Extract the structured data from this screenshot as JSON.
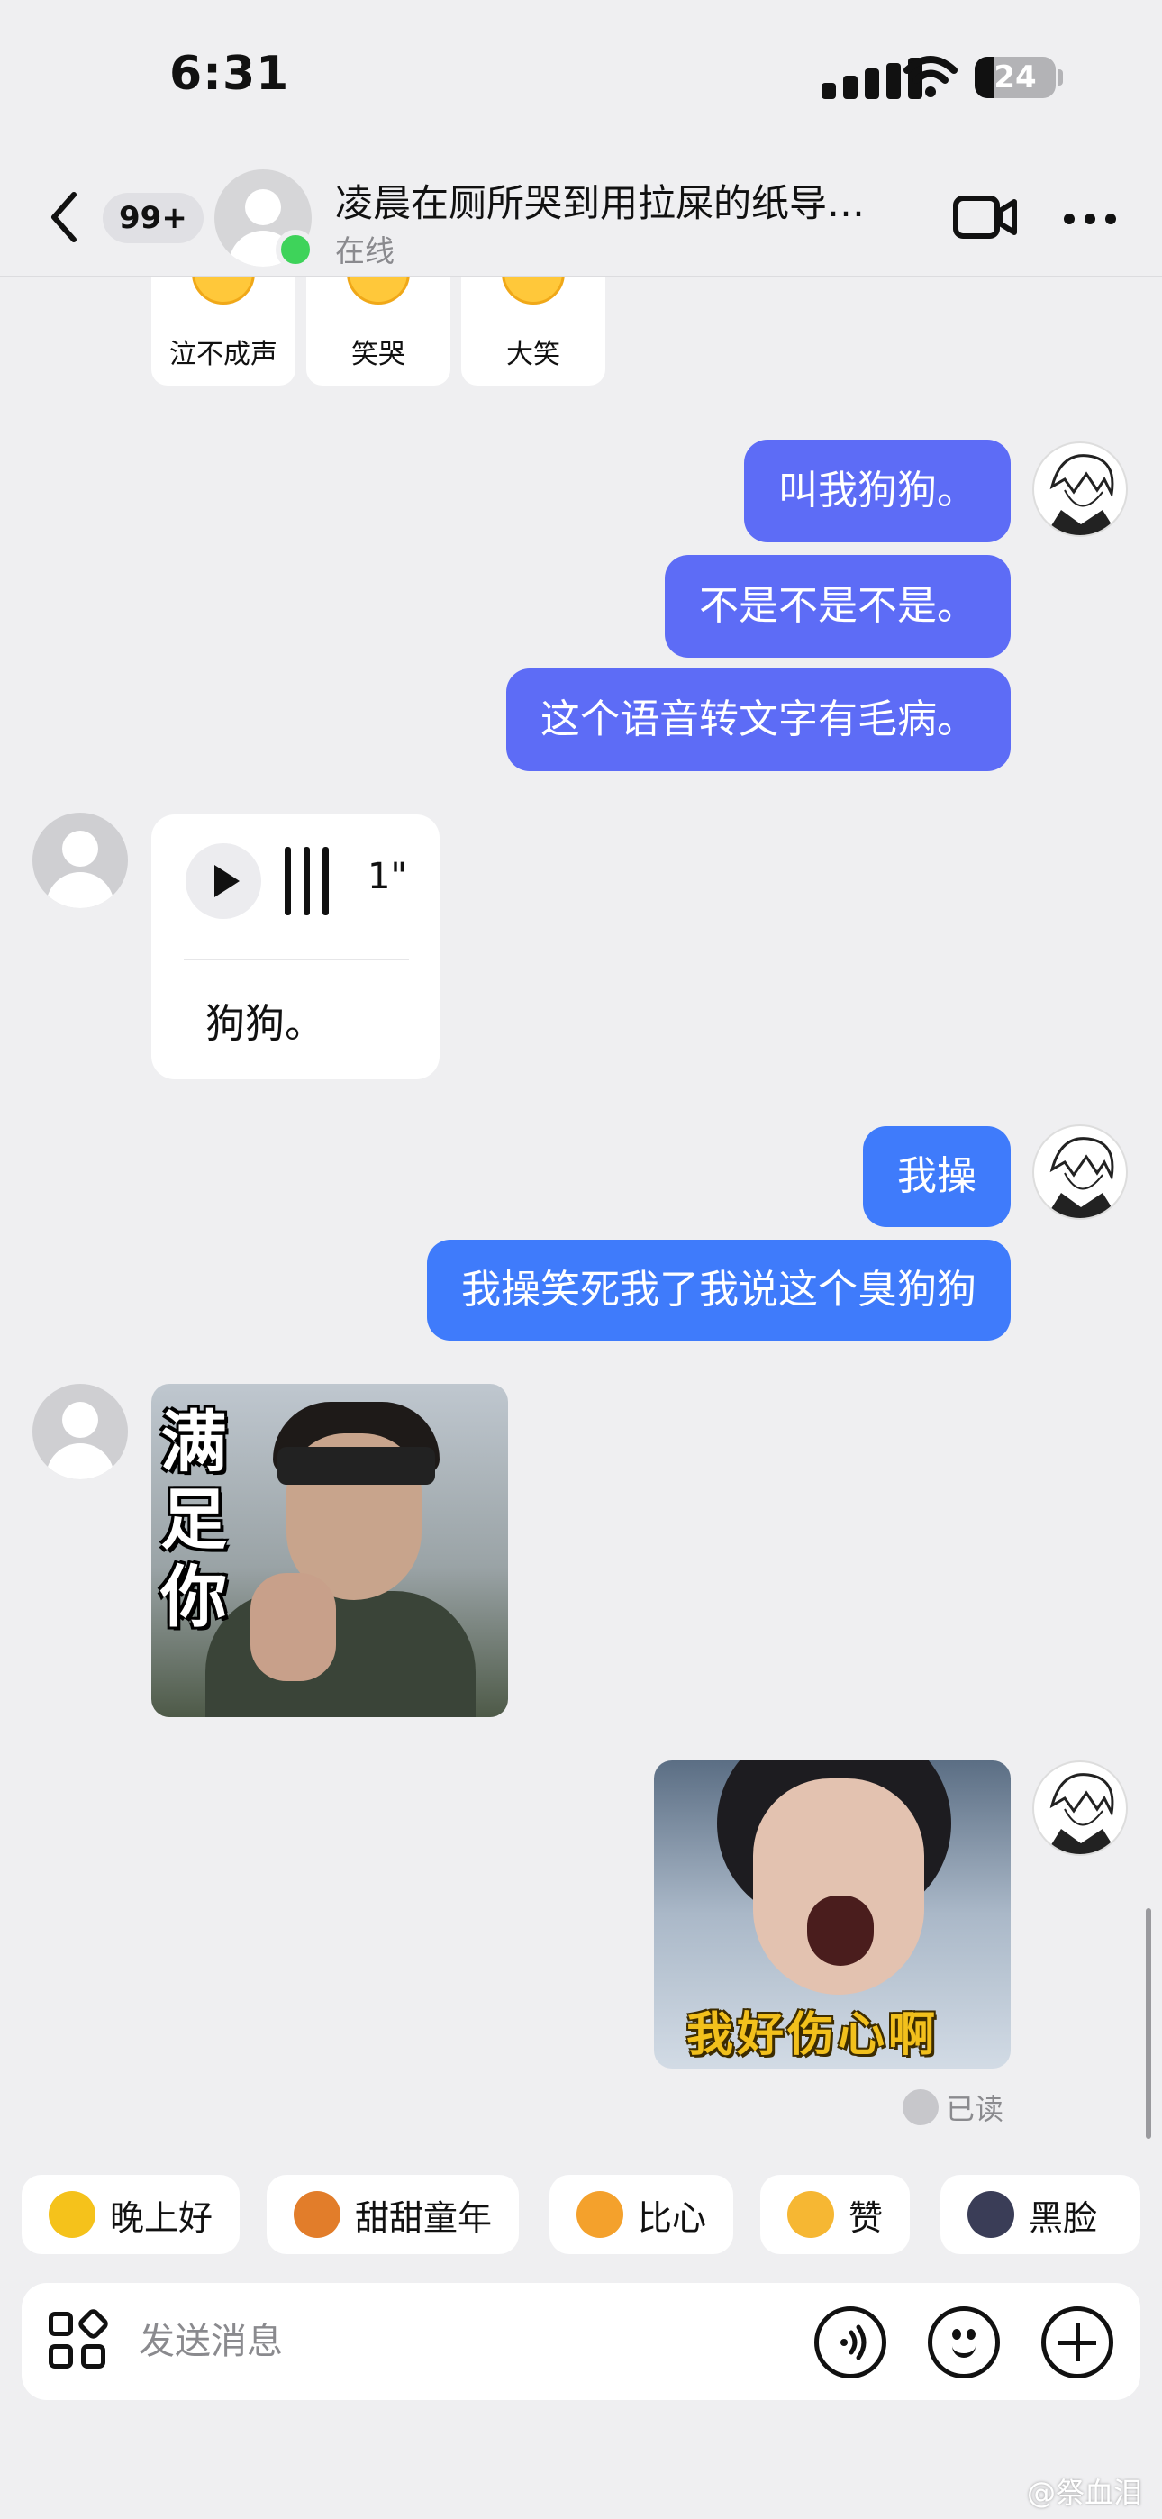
{
  "status_bar": {
    "time": "6:31",
    "battery": "24",
    "battery_level": 0.24
  },
  "header": {
    "back_count": "99+",
    "title": "凌晨在厕所哭到用拉屎的纸导…",
    "status": "在线"
  },
  "reactions": [
    {
      "label": "泣不成声",
      "icon": "crying-face-icon"
    },
    {
      "label": "笑哭",
      "icon": "tears-of-joy-icon"
    },
    {
      "label": "大笑",
      "icon": "laughing-face-icon"
    }
  ],
  "messages": {
    "m1": "叫我狗狗。",
    "m2": "不是不是不是。",
    "m3": "这个语音转文字有毛病。",
    "voice": {
      "duration": "1\"",
      "transcript": "狗狗。"
    },
    "m4": "我操",
    "m5": "我操笑死我了我说这个臭狗狗",
    "sticker1_caption": "满足你",
    "sticker2_caption": "我好伤心啊",
    "read_status": "已读"
  },
  "quick_replies": [
    {
      "label": "晚上好",
      "icon": "star-icon",
      "color": "#f5c21b"
    },
    {
      "label": "甜甜童年",
      "icon": "candy-icon",
      "color": "#e27d2a"
    },
    {
      "label": "比心",
      "icon": "heart-hand-icon",
      "color": "#f4a12c"
    },
    {
      "label": "赞",
      "icon": "thumbs-up-icon",
      "color": "#f6b733"
    },
    {
      "label": "黑脸",
      "icon": "dark-face-icon",
      "color": "#3a3d57"
    }
  ],
  "input": {
    "placeholder": "发送消息"
  },
  "watermark": "@祭血泪",
  "colors": {
    "bubble_blue": "#3f7bfb",
    "bubble_purple": "#5d6cf6",
    "online": "#3ed35a",
    "background": "#efeff1"
  }
}
